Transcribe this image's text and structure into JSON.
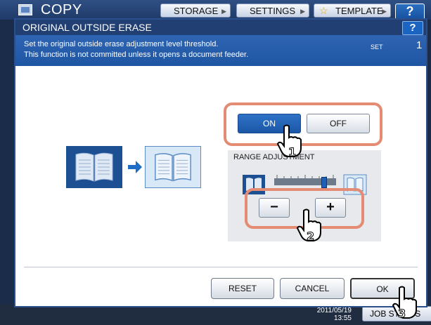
{
  "app": {
    "title": "COPY"
  },
  "topbar": {
    "storage_label": "STORAGE",
    "settings_label": "SETTINGS",
    "template_label": "TEMPLATE",
    "help_label": "?"
  },
  "dialog": {
    "title": "ORIGINAL OUTSIDE ERASE",
    "help_label": "?",
    "message_line1": "Set the original outside erase adjustment level threshold.",
    "message_line2": "This function is not committed unless it opens a document feeder.",
    "set_label": "SET",
    "set_number": "1"
  },
  "toggle": {
    "on_label": "ON",
    "off_label": "OFF",
    "selected": "ON"
  },
  "range": {
    "label": "RANGE ADJUSTMENT",
    "level": 0.8,
    "minus_label": "−",
    "plus_label": "+"
  },
  "footer": {
    "reset_label": "RESET",
    "cancel_label": "CANCEL",
    "ok_label": "OK"
  },
  "status": {
    "date": "2011/05/19",
    "time": "13:55",
    "job_label": "JOB STATUS"
  },
  "markers": {
    "m1": "1",
    "m2": "2",
    "m3": "3"
  },
  "colors": {
    "accent": "#1f56a4",
    "highlight": "#e48b73",
    "title_bar": "#213f72"
  }
}
